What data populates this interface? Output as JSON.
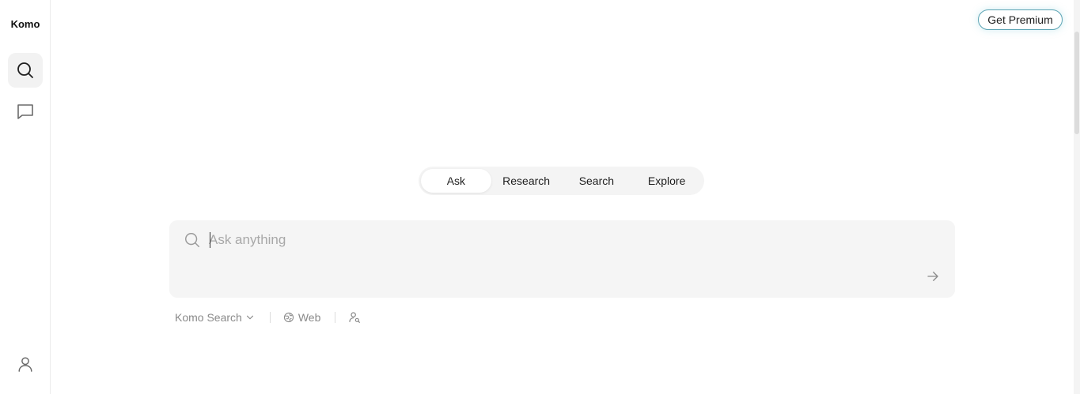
{
  "brand": "Komo",
  "sidebar": {
    "search_icon": "search-icon",
    "chat_icon": "chat-icon",
    "profile_icon": "user-icon"
  },
  "header": {
    "premium_label": "Get Premium"
  },
  "tabs": [
    {
      "label": "Ask",
      "active": true
    },
    {
      "label": "Research",
      "active": false
    },
    {
      "label": "Search",
      "active": false
    },
    {
      "label": "Explore",
      "active": false
    }
  ],
  "search": {
    "placeholder": "Ask anything",
    "value": ""
  },
  "options": {
    "engine_label": "Komo Search",
    "source_label": "Web",
    "persona_icon": "user-search-icon"
  },
  "colors": {
    "accent_border": "#5aa3b3",
    "box_bg": "#f5f5f5",
    "muted_text": "#8a8a8a"
  }
}
